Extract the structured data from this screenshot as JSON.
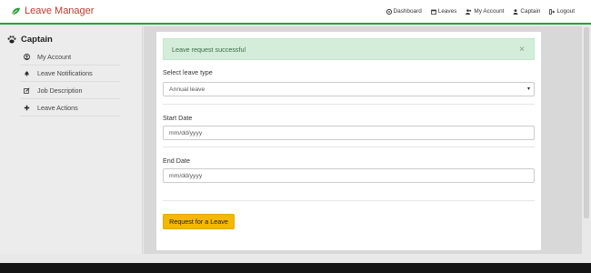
{
  "brand": {
    "title": "Leave Manager"
  },
  "nav": {
    "items": [
      {
        "label": "Dashboard",
        "icon": "dashboard-icon"
      },
      {
        "label": "Leaves",
        "icon": "calendar-icon"
      },
      {
        "label": "My Account",
        "icon": "user-group-icon"
      },
      {
        "label": "Captain",
        "icon": "user-icon"
      },
      {
        "label": "Logout",
        "icon": "logout-icon"
      }
    ]
  },
  "sidebar": {
    "title": "Captain",
    "items": [
      {
        "label": "My Account",
        "icon": "user-circle-icon"
      },
      {
        "label": "Leave Notifications",
        "icon": "bell-icon"
      },
      {
        "label": "Job Description",
        "icon": "edit-icon"
      },
      {
        "label": "Leave Actions",
        "icon": "plus-icon"
      }
    ]
  },
  "alert": {
    "message": "Leave request successful",
    "close": "×"
  },
  "form": {
    "leave_type_label": "Select leave type",
    "leave_type_value": "Annual leave",
    "start_label": "Start Date",
    "start_placeholder": "mm/dd/yyyy",
    "end_label": "End Date",
    "end_placeholder": "mm/dd/yyyy",
    "submit_label": "Request for a Leave"
  },
  "colors": {
    "brand": "#c0392b",
    "accent_green": "#2e9e3a",
    "alert_bg": "#d4edda",
    "button": "#f5b800"
  }
}
